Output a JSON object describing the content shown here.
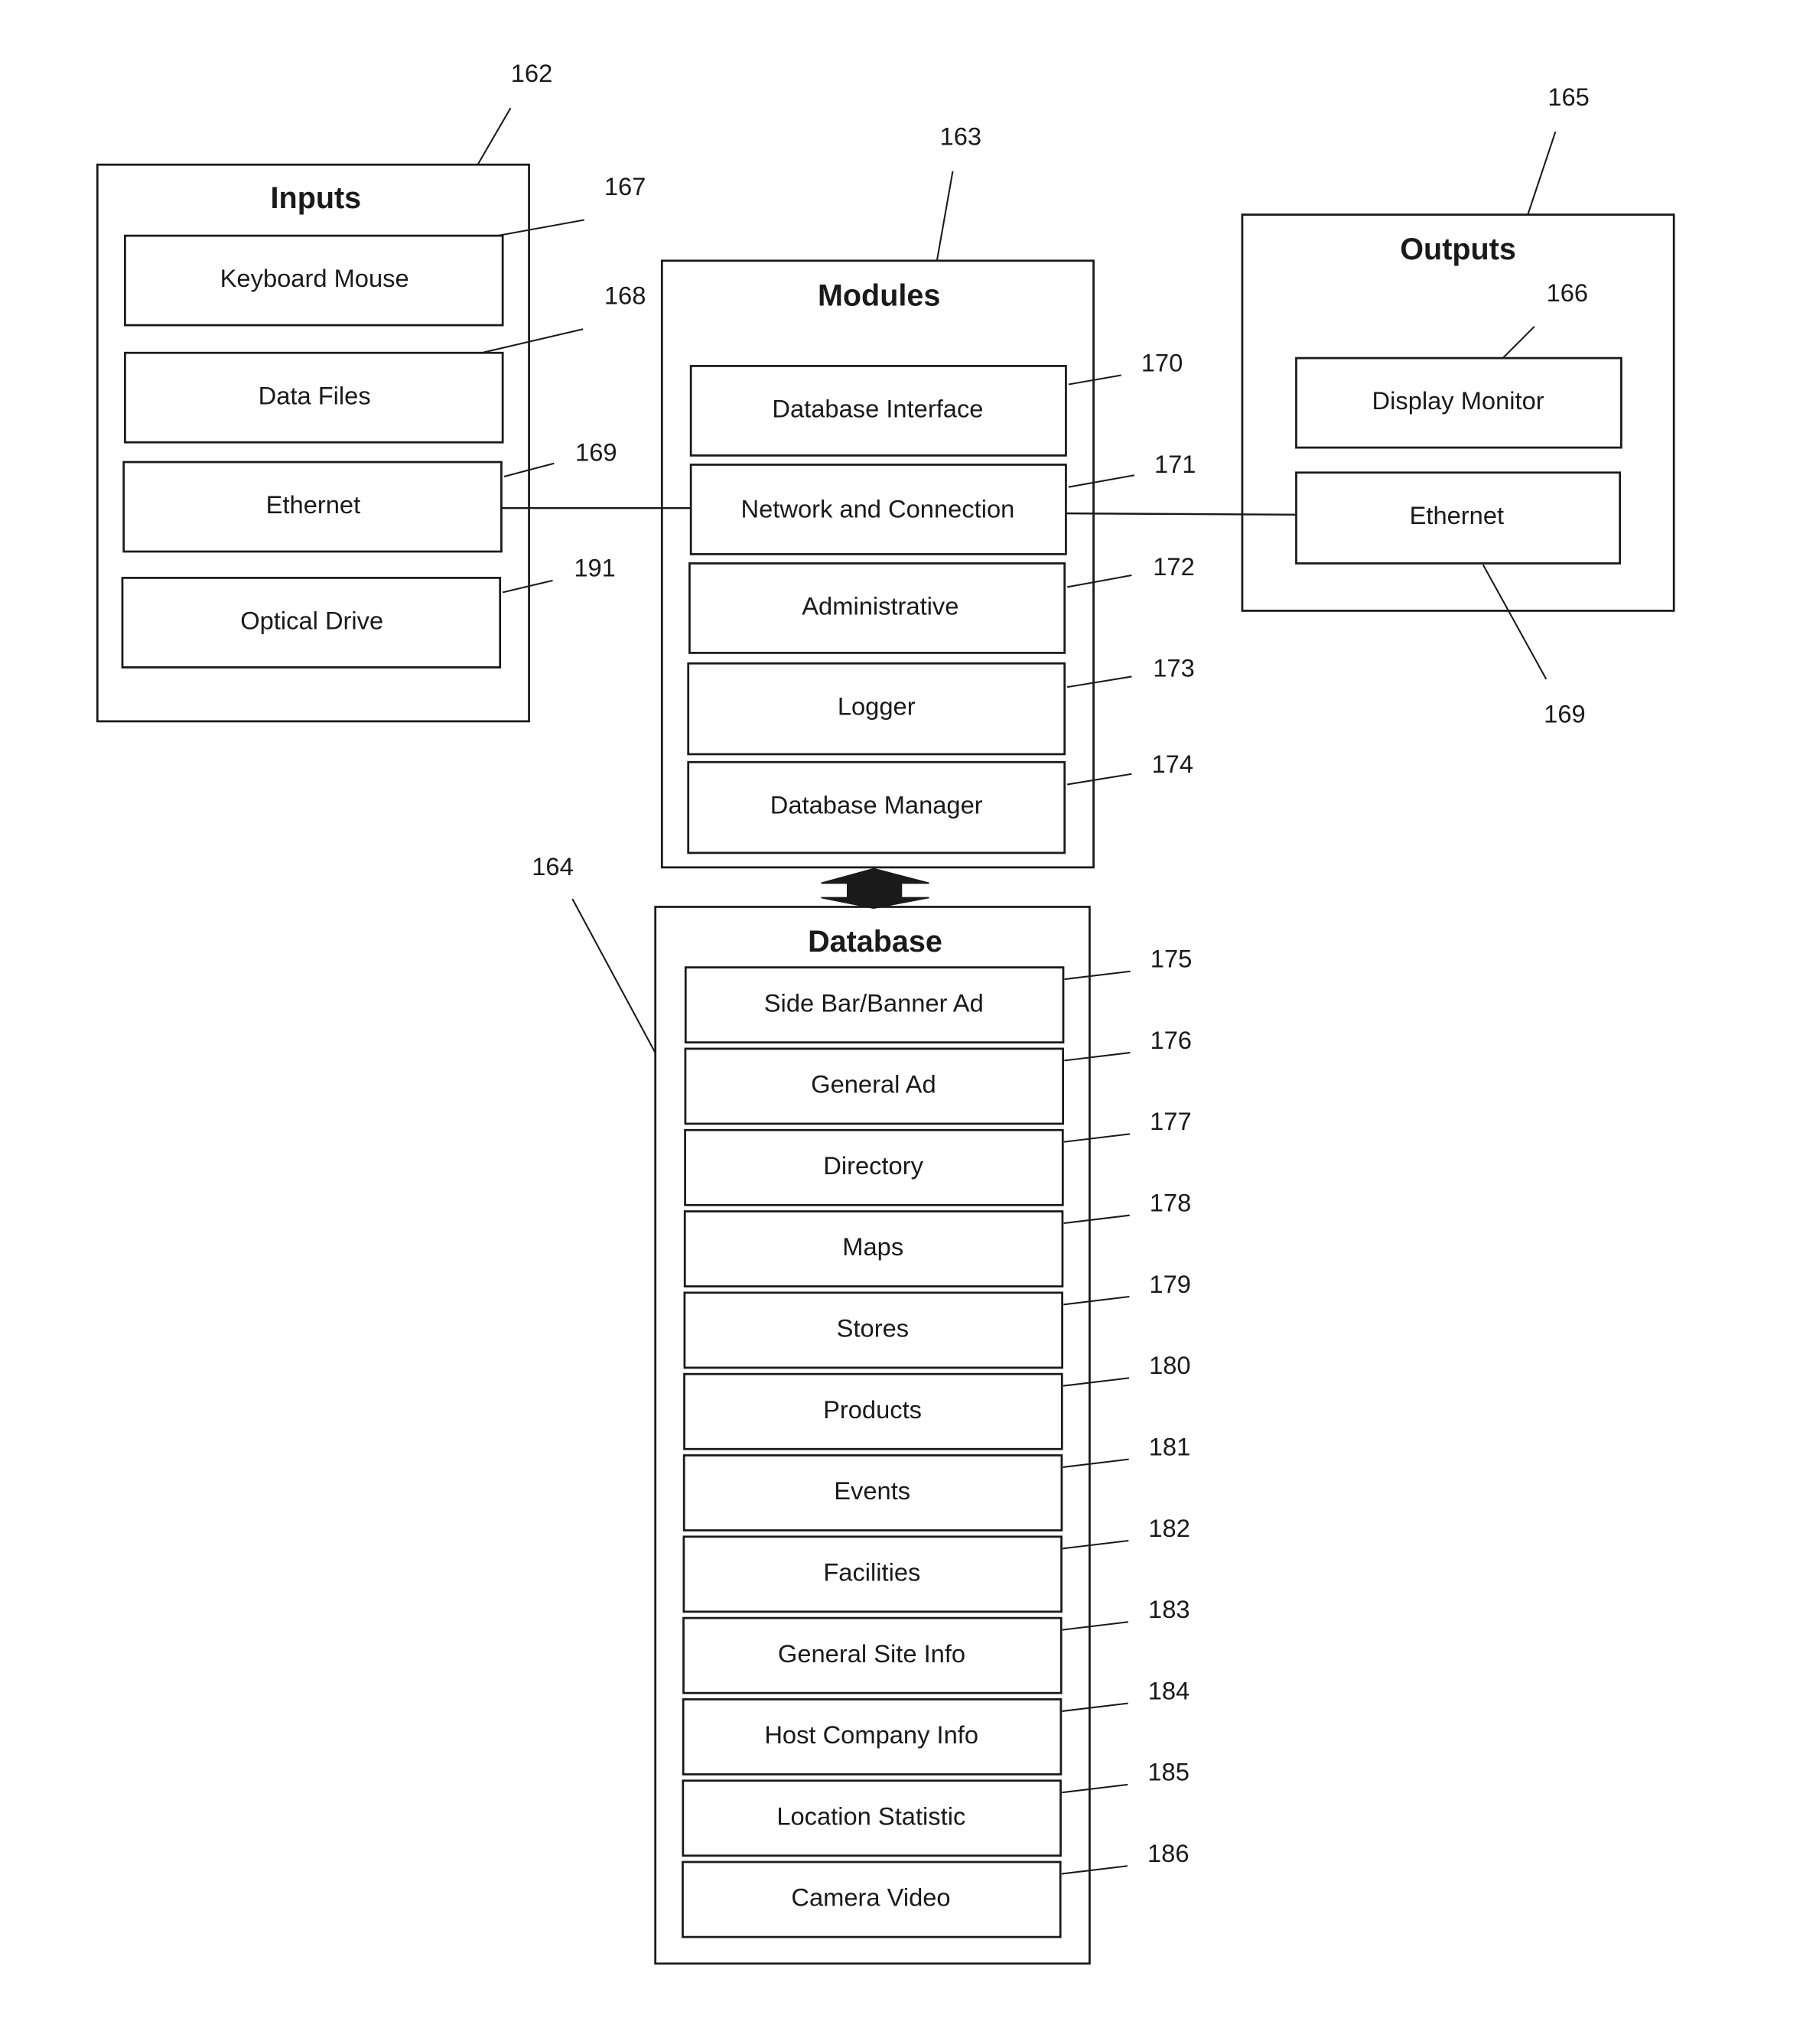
{
  "inputs": {
    "title": "Inputs",
    "ref": "162",
    "items": [
      {
        "label": "Keyboard Mouse",
        "ref": "167"
      },
      {
        "label": "Data Files",
        "ref": "168"
      },
      {
        "label": "Ethernet",
        "ref": "169"
      },
      {
        "label": "Optical Drive",
        "ref": "191"
      }
    ]
  },
  "modules": {
    "title": "Modules",
    "ref": "163",
    "items": [
      {
        "label": "Database Interface",
        "ref": "170"
      },
      {
        "label": "Network and Connection",
        "ref": "171"
      },
      {
        "label": "Administrative",
        "ref": "172"
      },
      {
        "label": "Logger",
        "ref": "173"
      },
      {
        "label": "Database Manager",
        "ref": "174"
      }
    ]
  },
  "outputs": {
    "title": "Outputs",
    "ref": "165",
    "items": [
      {
        "label": "Display Monitor",
        "ref": "166"
      },
      {
        "label": "Ethernet",
        "ref": "169"
      }
    ]
  },
  "database": {
    "title": "Database",
    "ref": "164",
    "items": [
      {
        "label": "Side Bar/Banner Ad",
        "ref": "175"
      },
      {
        "label": "General Ad",
        "ref": "176"
      },
      {
        "label": "Directory",
        "ref": "177"
      },
      {
        "label": "Maps",
        "ref": "178"
      },
      {
        "label": "Stores",
        "ref": "179"
      },
      {
        "label": "Products",
        "ref": "180"
      },
      {
        "label": "Events",
        "ref": "181"
      },
      {
        "label": "Facilities",
        "ref": "182"
      },
      {
        "label": "General Site Info",
        "ref": "183"
      },
      {
        "label": "Host Company Info",
        "ref": "184"
      },
      {
        "label": "Location Statistic",
        "ref": "185"
      },
      {
        "label": "Camera Video",
        "ref": "186"
      }
    ]
  }
}
